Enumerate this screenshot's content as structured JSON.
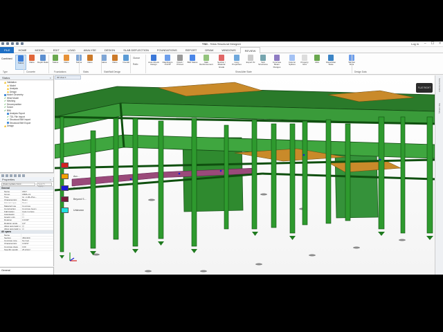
{
  "window": {
    "title_app": "TSD",
    "title_file": " - Tekla Structural Designer",
    "login": "Log in",
    "controls": [
      "–",
      "☐",
      "×"
    ]
  },
  "menu_tabs": [
    "FILE",
    "HOME",
    "MODEL",
    "EDIT",
    "LOAD",
    "ANALYSE",
    "DESIGN",
    "SLAB DEFLECTION",
    "FOUNDATIONS",
    "REPORT",
    "DRAW",
    "WINDOWS",
    "REVIEW"
  ],
  "ribbon": {
    "combined_label": "Combined",
    "buttons": [
      {
        "label": "Status",
        "color": "#3b7dd8",
        "selected": true
      },
      {
        "label": "Ratio",
        "color": "#e0663a"
      },
      {
        "label": "Depth Ratio",
        "color": "#5c8fd0"
      },
      {
        "label": "Status",
        "color": "#6aa84f"
      },
      {
        "label": "Ratio",
        "color": "#e69138"
      },
      {
        "label": "Status",
        "color": "#7fa6d6"
      },
      {
        "label": "Ratio",
        "color": "#cc7a29"
      },
      {
        "label": "Status",
        "color": "#7fa6d6"
      },
      {
        "label": "Ratio",
        "color": "#cc7a29"
      },
      {
        "label": "Overall",
        "color": "#5b9bd5"
      },
      {
        "label": "Auto-Check Design",
        "color": "#3c78d8"
      },
      {
        "label": "Diaphragm On/Off",
        "color": "#6d9eeb"
      },
      {
        "label": "Fixed / Pinned",
        "color": "#999999"
      },
      {
        "label": "BIM Status",
        "color": "#4a86e8"
      },
      {
        "label": "Slab Reinforcement",
        "color": "#93c47d"
      },
      {
        "label": "Section / Material Grade",
        "color": "#e06666"
      },
      {
        "label": "Copy Properties",
        "color": "#6fa8dc"
      },
      {
        "label": "Export Ifc",
        "color": "#cccccc"
      },
      {
        "label": "Sub Structures",
        "color": "#76a5af"
      },
      {
        "label": "Concrete Beam Flanges",
        "color": "#8e7cc3"
      },
      {
        "label": "Column Splices",
        "color": "#a4c2f4"
      },
      {
        "label": "Property Grid",
        "color": "#dddddd"
      },
      {
        "label": "UDA",
        "color": "#6aa84f"
      },
      {
        "label": "Show/Alter State",
        "color": "#3d85c6"
      },
      {
        "label": "Tabular Data",
        "color": "#6d9eeb"
      }
    ],
    "side_options": [
      "Glance",
      "Ratio"
    ],
    "groups": [
      "Type",
      "Concrete",
      "Foundations",
      "Slabs",
      "Slab/Wall Design",
      "Show/Alter State",
      "Design Data"
    ]
  },
  "status_panel": {
    "title": "Status",
    "items": [
      {
        "label": "Validation",
        "mark": "warn",
        "indent": 1
      },
      {
        "label": "Model",
        "mark": "warn",
        "indent": 2
      },
      {
        "label": "Analysis",
        "mark": "warn",
        "indent": 2
      },
      {
        "label": "Design",
        "mark": "warn",
        "indent": 2
      },
      {
        "label": "Model Geometry",
        "mark": "sq",
        "indent": 1
      },
      {
        "label": "Wind Model",
        "mark": "ok",
        "indent": 1
      },
      {
        "label": "Meshing",
        "mark": "ok",
        "indent": 1
      },
      {
        "label": "Decomposition",
        "mark": "ok",
        "indent": 1
      },
      {
        "label": "Solver",
        "mark": "ok",
        "indent": 1
      },
      {
        "label": "BIM",
        "mark": "ok",
        "indent": 1
      },
      {
        "label": "Analysis Export",
        "mark": "sq",
        "indent": 2
      },
      {
        "label": "TDL File Import",
        "mark": "ok",
        "indent": 2
      },
      {
        "label": "Structural BIM Import",
        "mark": "ok",
        "indent": 2
      },
      {
        "label": "Structural BIM Export",
        "mark": "sq",
        "indent": 2
      },
      {
        "label": "Design",
        "mark": "warn",
        "indent": 1
      }
    ]
  },
  "properties": {
    "title": "Properties",
    "filter": "(Cast-in-place Conc...",
    "search": "Search... Apply...",
    "general_header": "General",
    "general": [
      {
        "k": "Name",
        "v": "1B17"
      },
      {
        "k": "Group",
        "v": "1B08+C1"
      },
      {
        "k": "Type",
        "v": "Gr. 2-1B+Plus..."
      },
      {
        "k": "Characteristic",
        "v": "Beam"
      },
      {
        "k": "Element type",
        "v": "Beam",
        "muted": true
      },
      {
        "k": "Material type",
        "v": "Concrete"
      },
      {
        "k": "Construction",
        "v": "Concrete beam"
      },
      {
        "k": "Fabrication",
        "v": "Cast-in-place"
      },
      {
        "k": "Autodesign",
        "v": "☐"
      },
      {
        "k": "Gravity only",
        "v": "☐"
      },
      {
        "k": "Rotation",
        "v": "0.0000°"
      },
      {
        "k": "Rotation angle",
        "v": "0.0°"
      },
      {
        "k": "Allow automatic c...",
        "v": "☑"
      },
      {
        "k": "Allow automatic s...",
        "v": "☑"
      }
    ],
    "spans_header": "All spans",
    "spans": [
      {
        "k": "Name",
        "v": ""
      },
      {
        "k": "Section",
        "v": "450x300"
      },
      {
        "k": "Concrete type",
        "v": "Normal"
      },
      {
        "k": "Characteristic",
        "v": "C30/37"
      },
      {
        "k": "Concrete class",
        "v": "C30"
      },
      {
        "k": "Specific weight",
        "v": "25 kN/m³"
      }
    ],
    "general_field": "General"
  },
  "viewport": {
    "tab_label": "3D View 1",
    "viewcube_label": "FLAT RIGHT",
    "legend": [
      {
        "color": "#d42020",
        "label": ""
      },
      {
        "color": "#f0a000",
        "label": "Acc..."
      },
      {
        "color": "#1a1ad6",
        "label": "Fixing"
      },
      {
        "color": "#7a1a3a",
        "label": "Beyond S..."
      },
      {
        "color": "#20e0e0",
        "label": "Unknown"
      }
    ],
    "right_strip": [
      "Scene Content",
      "Site Library"
    ]
  }
}
